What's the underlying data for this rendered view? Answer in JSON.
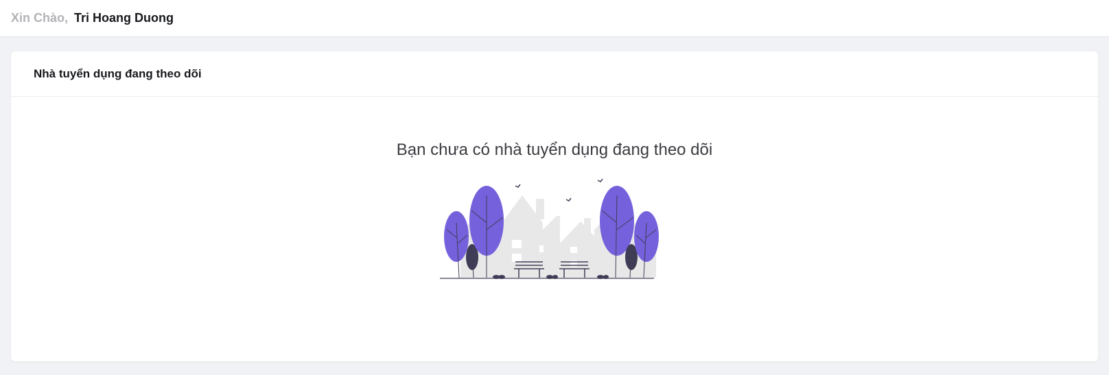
{
  "header": {
    "greeting": "Xin Chào,",
    "username": "Tri Hoang Duong"
  },
  "card": {
    "title": "Nhà tuyển dụng đang theo dõi",
    "empty_message": "Bạn chưa có nhà tuyển dụng đang theo dõi"
  },
  "colors": {
    "accent": "#7661dc",
    "dark_tree": "#3f3d56",
    "building": "#e6e6e6"
  }
}
